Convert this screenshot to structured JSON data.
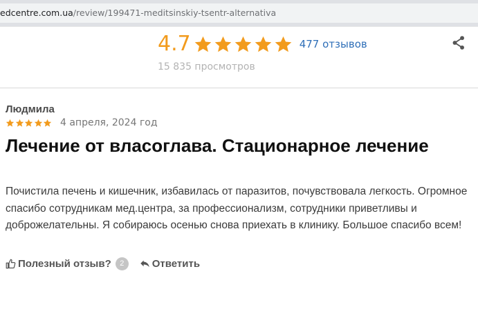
{
  "browser": {
    "url_domain": "edcentre.com.ua",
    "url_path": "/review/199471-meditsinskiy-tsentr-alternativa"
  },
  "rating": {
    "value": "4.7",
    "stars": 5,
    "reviews_link": "477 отзывов",
    "views": "15 835 просмотров",
    "star_color": "#f29b1d"
  },
  "review": {
    "author": "Людмила",
    "stars": 5,
    "date": "4 апреля, 2024 год",
    "title": "Лечение от власоглава. Стационарное лечение",
    "body": "Почистила печень и кишечник, избавилась от паразитов, почувствовала легкость. Огромное спасибо сотрудникам мед.центра, за профессионализм, сотрудники приветливы и доброжелательны. Я собираюсь осенью снова приехать в клинику. Большое спасибо всем!",
    "helpful_label": "Полезный отзыв?",
    "helpful_count": "2",
    "reply_label": "Ответить"
  },
  "icons": {
    "share": "share-icon",
    "thumbs_up": "thumbs-up-icon",
    "reply": "reply-arrow-icon",
    "star": "star-icon"
  }
}
